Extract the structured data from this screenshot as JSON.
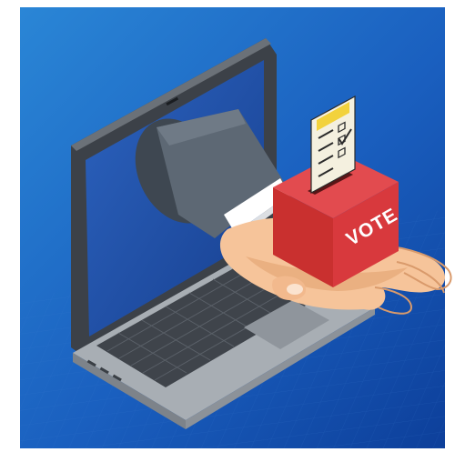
{
  "illustration": {
    "ballot_box_label": "VOTE"
  },
  "colors": {
    "background_light": "#2a86d6",
    "background_dark": "#0d3f9a",
    "laptop_body": "#9aa1a8",
    "laptop_bezel": "#3c4148",
    "screen": "#1f4fa6",
    "sleeve": "#5d6874",
    "hand": "#f6c49a",
    "ballot_box": "#d8393d",
    "ballot_paper": "#f4f0df",
    "ballot_highlight": "#f2d23c"
  },
  "icons": [
    "laptop-icon",
    "hand-icon",
    "ballot-box-icon",
    "ballot-paper-icon"
  ]
}
